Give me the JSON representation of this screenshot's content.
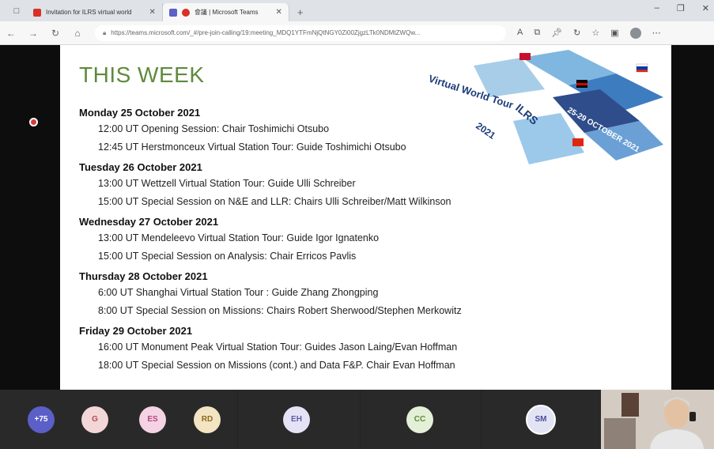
{
  "browser": {
    "tabs": [
      {
        "label": "Invitation for ILRS virtual world",
        "favicon_color": "#d93025"
      },
      {
        "label": "會議 | Microsoft Teams",
        "favicon_color": "#5b5fc7"
      }
    ],
    "url": "https://teams.microsoft.com/_#/pre-join-calling/19:meeting_MDQ1YTFmNjQtNGY0Zi00ZjgzLTk0NDMtZWQw..."
  },
  "slide": {
    "title": "THIS WEEK",
    "banner": {
      "line1": "Virtual World Tour",
      "line2": "ILRS",
      "line3": "2021",
      "dates": "25-29 OCTOBER 2021"
    },
    "days": [
      {
        "date": "Monday 25 October 2021",
        "items": [
          "12:00 UT Opening Session: Chair Toshimichi Otsubo",
          "12:45 UT Herstmonceux Virtual Station Tour:  Guide Toshimichi Otsubo"
        ]
      },
      {
        "date": "Tuesday 26 October 2021",
        "items": [
          "13:00 UT Wettzell Virtual Station Tour: Guide Ulli Schreiber",
          "15:00 UT Special Session on N&E and LLR: Chairs Ulli Schreiber/Matt Wilkinson"
        ]
      },
      {
        "date": "Wednesday 27 October 2021",
        "items": [
          "13:00 UT Mendeleevo Virtual Station Tour: Guide Igor Ignatenko",
          "15:00 UT Special Session on Analysis: Chair Erricos Pavlis"
        ]
      },
      {
        "date": "Thursday 28 October 2021",
        "items": [
          "6:00 UT Shanghai Virtual Station Tour : Guide Zhang Zhongping",
          "8:00 UT Special Session on Missions: Chairs Robert Sherwood/Stephen Merkowitz"
        ]
      },
      {
        "date": "Friday 29 October 2021",
        "items": [
          "16:00 UT Monument Peak Virtual Station Tour: Guides Jason Laing/Evan Hoffman",
          "18:00 UT Special Session on Missions (cont.) and Data F&P. Chair Evan Hoffman"
        ]
      }
    ]
  },
  "participants": [
    {
      "initials": "+75",
      "bg": "#5b5fc7",
      "fg": "#ffffff"
    },
    {
      "initials": "G",
      "bg": "#f3d6d8",
      "fg": "#b44a55"
    },
    {
      "initials": "ES",
      "bg": "#f4d3e4",
      "fg": "#b4477c"
    },
    {
      "initials": "RD",
      "bg": "#f3e4c2",
      "fg": "#8c6a1f"
    },
    {
      "initials": "EH",
      "bg": "#e4e2f4",
      "fg": "#5f5aa8"
    },
    {
      "initials": "CC",
      "bg": "#e3efd6",
      "fg": "#5f8a3c"
    },
    {
      "initials": "SM",
      "bg": "#e2e4f4",
      "fg": "#4b4f9c"
    }
  ]
}
